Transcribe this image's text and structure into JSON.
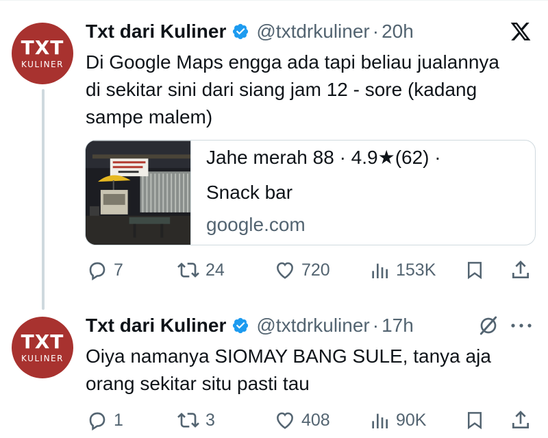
{
  "colors": {
    "avatar_bg": "#a8322f",
    "verified_blue": "#1d9bf0",
    "text_primary": "#0f1419",
    "text_secondary": "#536471",
    "border": "#cfd9de"
  },
  "tweets": [
    {
      "avatar": {
        "main": "TXT",
        "sub": "KULINER"
      },
      "name": "Txt dari Kuliner",
      "handle": "@txtdrkuliner",
      "separator": "·",
      "time": "20h",
      "text_lines": [
        "Di Google Maps engga ada tapi beliau jualannya",
        "di sekitar sini dari siang jam 12 - sore (kadang",
        "sampe malem)"
      ],
      "card": {
        "line1": "Jahe merah 88 · 4.9★(62) ·",
        "line2": "Snack bar",
        "domain": "google.com",
        "thumbnail_icon": "storefront-night-photo"
      },
      "actions": {
        "replies": "7",
        "reposts": "24",
        "likes": "720",
        "views": "153K"
      }
    },
    {
      "avatar": {
        "main": "TXT",
        "sub": "KULINER"
      },
      "name": "Txt dari Kuliner",
      "handle": "@txtdrkuliner",
      "separator": "·",
      "time": "17h",
      "text_lines": [
        "Oiya namanya SIOMAY BANG SULE, tanya aja",
        "orang sekitar situ pasti tau"
      ],
      "actions": {
        "replies": "1",
        "reposts": "3",
        "likes": "408",
        "views": "90K"
      }
    }
  ],
  "icons": {
    "platform": "x-logo-icon",
    "grok": "grok-slash-icon",
    "more": "more-dots-icon",
    "reply": "reply-icon",
    "repost": "repost-icon",
    "like": "heart-icon",
    "views": "views-bars-icon",
    "bookmark": "bookmark-icon",
    "share": "share-icon"
  }
}
